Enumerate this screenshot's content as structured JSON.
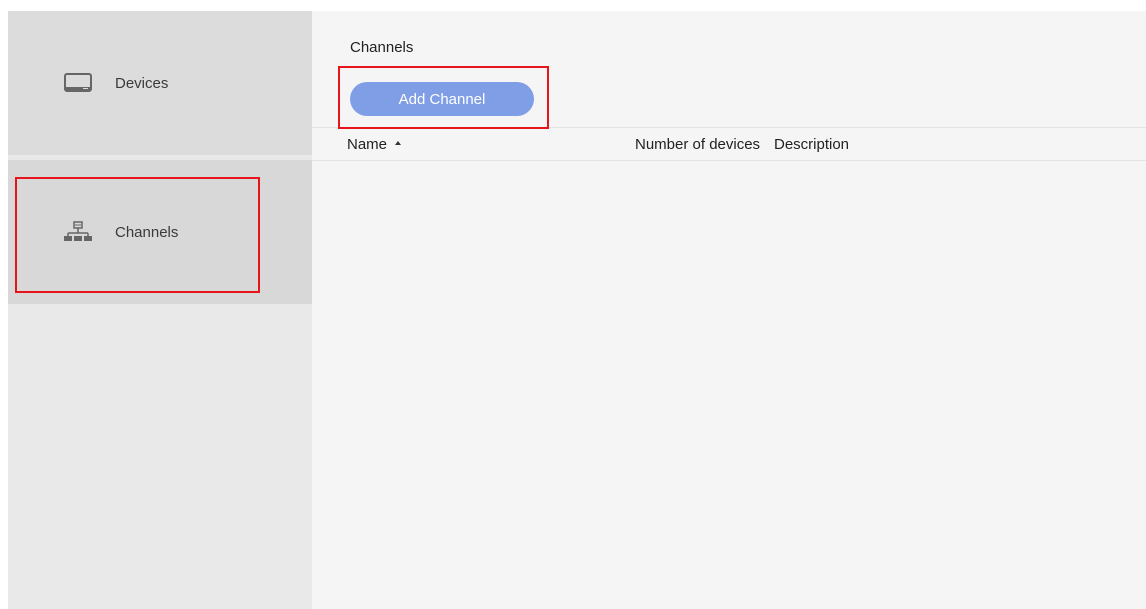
{
  "sidebar": {
    "items": [
      {
        "label": "Devices",
        "icon": "monitor-icon"
      },
      {
        "label": "Channels",
        "icon": "network-hierarchy-icon"
      }
    ]
  },
  "main": {
    "title": "Channels",
    "add_button_label": "Add Channel",
    "table": {
      "columns": [
        {
          "label": "Name",
          "sort": "ascending"
        },
        {
          "label": "Number of devices"
        },
        {
          "label": "Description"
        }
      ],
      "rows": []
    }
  },
  "colors": {
    "accent_button": "#7f9ee6",
    "highlight_box": "#e8141b",
    "sidebar_bg": "#e9e9e9",
    "main_bg": "#f5f5f5"
  }
}
